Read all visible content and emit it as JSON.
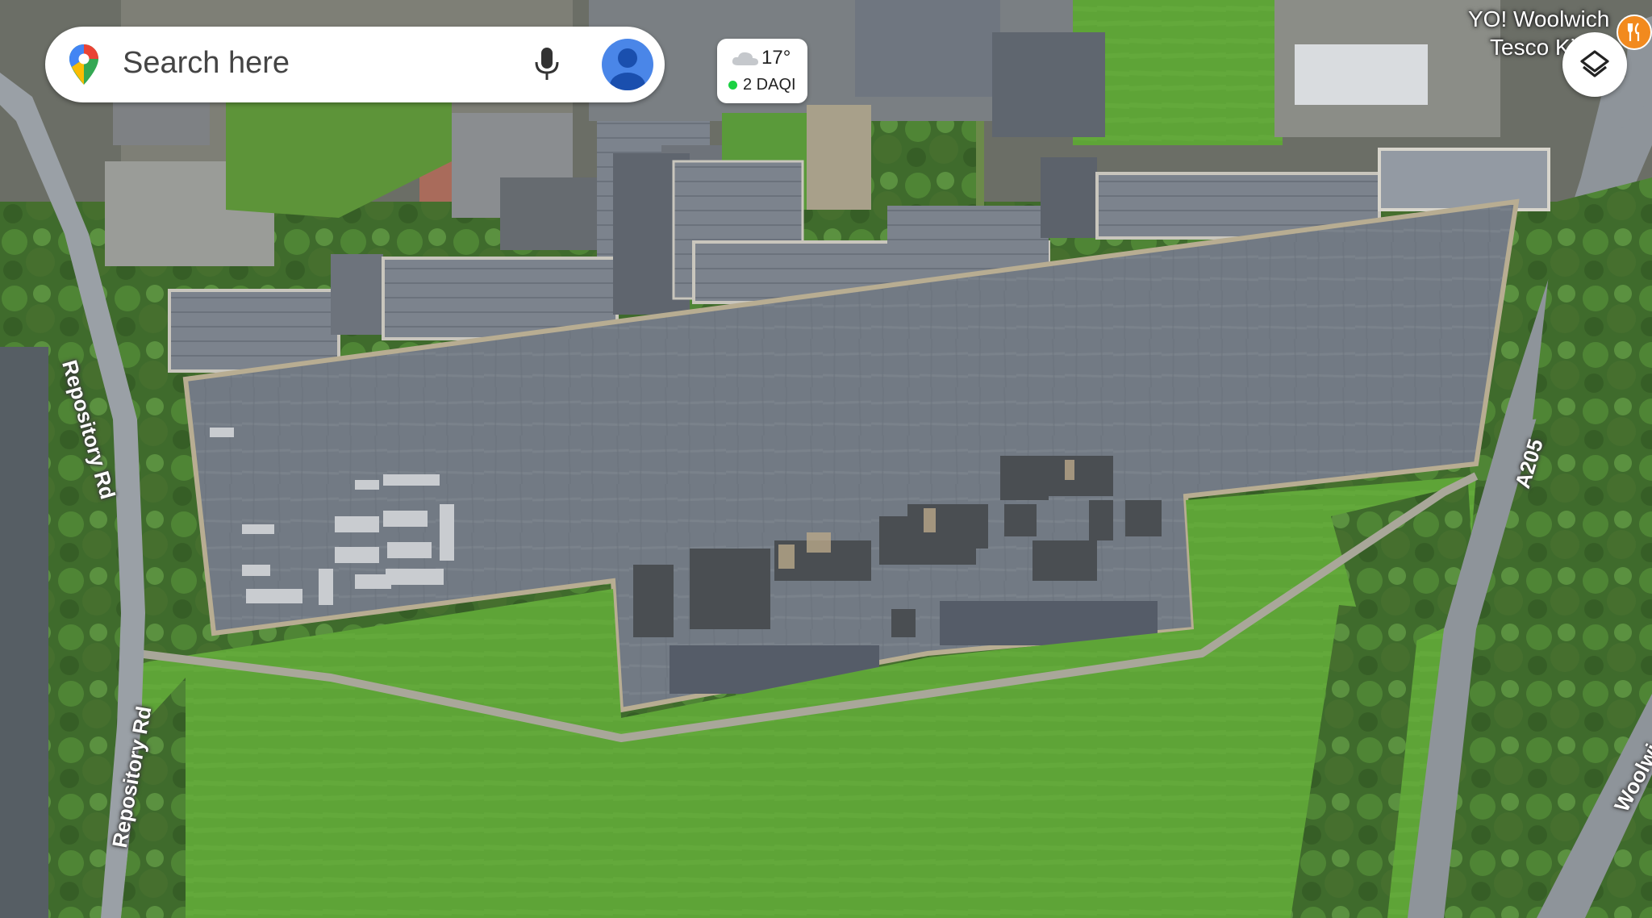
{
  "search": {
    "placeholder": "Search here"
  },
  "weather": {
    "temperature": "17°",
    "aqi": "2 DAQI",
    "aqi_color": "#1bd142"
  },
  "map_labels": {
    "repository_rd_upper": "Repository Rd",
    "repository_rd_lower": "Repository Rd",
    "a205": "A205",
    "woolwich_road": "Woolwi",
    "poi_line1": "YO! Woolwich",
    "poi_line2": "Tesco Ki"
  },
  "icons": {
    "maps_logo": "google-maps-pin-icon",
    "mic": "microphone-icon",
    "avatar": "account-avatar-icon",
    "weather": "cloud-icon",
    "layers": "layers-icon",
    "poi": "restaurant-icon"
  },
  "colors": {
    "accent": "#4285f4",
    "grass": "#5fa33a",
    "parade_ground": "#707780",
    "roofs": "#8a9099"
  }
}
